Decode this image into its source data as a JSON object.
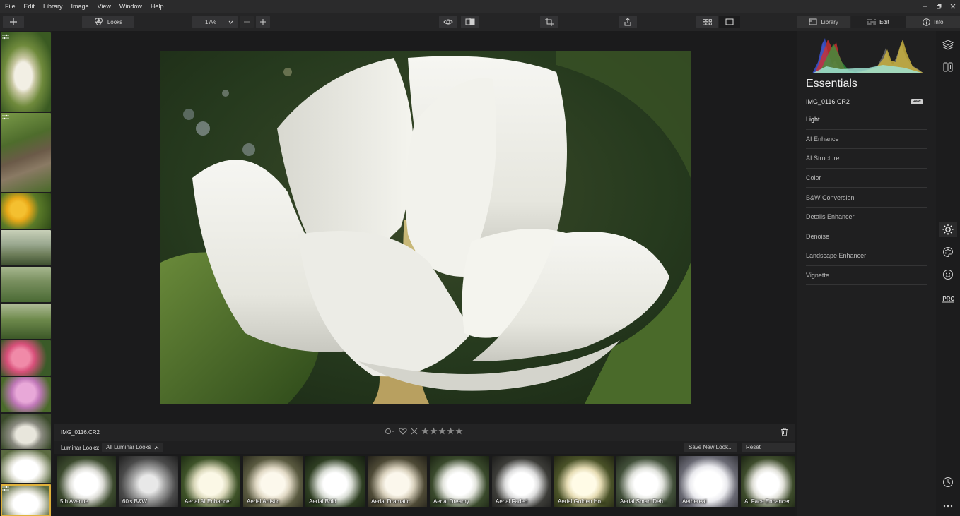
{
  "menu": [
    "File",
    "Edit",
    "Library",
    "Image",
    "View",
    "Window",
    "Help"
  ],
  "toolbar": {
    "looks_label": "Looks",
    "zoom_value": "17%"
  },
  "right_tabs": [
    {
      "label": "Library"
    },
    {
      "label": "Edit"
    },
    {
      "label": "Info"
    }
  ],
  "panel": {
    "title": "Essentials",
    "filename": "IMG_0116.CR2",
    "raw_badge": "RAW",
    "tools": [
      "Light",
      "AI Enhance",
      "AI Structure",
      "Color",
      "B&W Conversion",
      "Details Enhancer",
      "Denoise",
      "Landscape Enhancer",
      "Vignette"
    ]
  },
  "info_bar": {
    "filename": "IMG_0116.CR2",
    "rating_stars": 5
  },
  "looks_bar": {
    "label": "Luminar Looks:",
    "selected": "All Luminar Looks",
    "save_button": "Save New Look...",
    "reset_button": "Reset Adjustments"
  },
  "looks": [
    "5th Avenue",
    "60's B&W",
    "Aerial AI Enhancer",
    "Aerial Artistic",
    "Aerial Bold",
    "Aerial Dramatic",
    "Aerial Dreamy",
    "Aerial Faded",
    "Aerial Golden Ho...",
    "Aerial Smart Deh...",
    "Aethereal",
    "AI Face Enhancer"
  ],
  "filmstrip_count": 11,
  "colors": {
    "accent_selected": "#e0b13a",
    "panel_bg": "#1f1f20"
  }
}
